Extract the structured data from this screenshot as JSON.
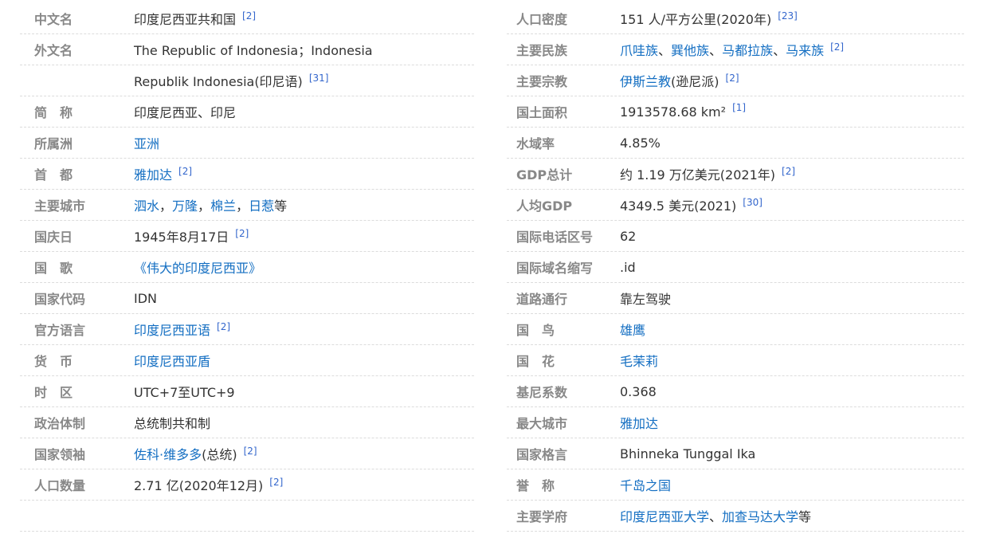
{
  "link_color": "#136ec2",
  "label_color": "#888888",
  "left": [
    {
      "label": "中文名",
      "segments": [
        {
          "t": "印度尼西亚共和国",
          "link": false
        }
      ],
      "ref": "[2]"
    },
    {
      "label": "外文名",
      "segments": [
        {
          "t": "The Republic of Indonesia；Indonesia",
          "link": false
        }
      ],
      "ref": ""
    },
    {
      "label": "",
      "segments": [
        {
          "t": "Republik Indonesia(印尼语)",
          "link": false
        }
      ],
      "ref": "[31]"
    },
    {
      "label": "简　称",
      "segments": [
        {
          "t": "印度尼西亚、印尼",
          "link": false
        }
      ],
      "ref": ""
    },
    {
      "label": "所属洲",
      "segments": [
        {
          "t": "亚洲",
          "link": true
        }
      ],
      "ref": ""
    },
    {
      "label": "首　都",
      "segments": [
        {
          "t": "雅加达",
          "link": true
        }
      ],
      "ref": "[2]"
    },
    {
      "label": "主要城市",
      "segments": [
        {
          "t": "泗水",
          "link": true
        },
        {
          "t": "，",
          "link": false
        },
        {
          "t": "万隆",
          "link": true
        },
        {
          "t": "，",
          "link": false
        },
        {
          "t": "棉兰",
          "link": true
        },
        {
          "t": "，",
          "link": false
        },
        {
          "t": "日惹",
          "link": true
        },
        {
          "t": "等",
          "link": false
        }
      ],
      "ref": ""
    },
    {
      "label": "国庆日",
      "segments": [
        {
          "t": "1945年8月17日",
          "link": false
        }
      ],
      "ref": "[2]"
    },
    {
      "label": "国　歌",
      "segments": [
        {
          "t": "《伟大的印度尼西亚》",
          "link": true
        }
      ],
      "ref": ""
    },
    {
      "label": "国家代码",
      "segments": [
        {
          "t": "IDN",
          "link": false
        }
      ],
      "ref": ""
    },
    {
      "label": "官方语言",
      "segments": [
        {
          "t": "印度尼西亚语",
          "link": true
        }
      ],
      "ref": "[2]"
    },
    {
      "label": "货　币",
      "segments": [
        {
          "t": "印度尼西亚盾",
          "link": true
        }
      ],
      "ref": ""
    },
    {
      "label": "时　区",
      "segments": [
        {
          "t": "UTC+7至UTC+9",
          "link": false
        }
      ],
      "ref": ""
    },
    {
      "label": "政治体制",
      "segments": [
        {
          "t": "总统制共和制",
          "link": false
        }
      ],
      "ref": ""
    },
    {
      "label": "国家领袖",
      "segments": [
        {
          "t": "佐科·维多多",
          "link": true
        },
        {
          "t": "(总统)",
          "link": false
        }
      ],
      "ref": "[2]"
    },
    {
      "label": "人口数量",
      "segments": [
        {
          "t": "2.71 亿(2020年12月)",
          "link": false
        }
      ],
      "ref": "[2]"
    },
    {
      "label": "",
      "segments": [],
      "ref": ""
    }
  ],
  "right": [
    {
      "label": "人口密度",
      "segments": [
        {
          "t": "151 人/平方公里(2020年)",
          "link": false
        }
      ],
      "ref": "[23]"
    },
    {
      "label": "主要民族",
      "segments": [
        {
          "t": "爪哇族",
          "link": true
        },
        {
          "t": "、",
          "link": false
        },
        {
          "t": "巽他族",
          "link": true
        },
        {
          "t": "、",
          "link": false
        },
        {
          "t": "马都拉族",
          "link": true
        },
        {
          "t": "、",
          "link": false
        },
        {
          "t": "马来族",
          "link": true
        }
      ],
      "ref": "[2]"
    },
    {
      "label": "主要宗教",
      "segments": [
        {
          "t": "伊斯兰教",
          "link": true
        },
        {
          "t": "(逊尼派)",
          "link": false
        }
      ],
      "ref": "[2]"
    },
    {
      "label": "国土面积",
      "segments": [
        {
          "t": "1913578.68 km²",
          "link": false
        }
      ],
      "ref": "[1]"
    },
    {
      "label": "水域率",
      "segments": [
        {
          "t": "4.85%",
          "link": false
        }
      ],
      "ref": ""
    },
    {
      "label": "GDP总计",
      "segments": [
        {
          "t": "约 1.19 万亿美元(2021年)",
          "link": false
        }
      ],
      "ref": "[2]"
    },
    {
      "label": "人均GDP",
      "segments": [
        {
          "t": "4349.5 美元(2021)",
          "link": false
        }
      ],
      "ref": "[30]"
    },
    {
      "label": "国际电话区号",
      "segments": [
        {
          "t": "62",
          "link": false
        }
      ],
      "ref": ""
    },
    {
      "label": "国际域名缩写",
      "segments": [
        {
          "t": ".id",
          "link": false
        }
      ],
      "ref": ""
    },
    {
      "label": "道路通行",
      "segments": [
        {
          "t": "靠左驾驶",
          "link": false
        }
      ],
      "ref": ""
    },
    {
      "label": "国　鸟",
      "segments": [
        {
          "t": "雄鹰",
          "link": true
        }
      ],
      "ref": ""
    },
    {
      "label": "国　花",
      "segments": [
        {
          "t": "毛茉莉",
          "link": true
        }
      ],
      "ref": ""
    },
    {
      "label": "基尼系数",
      "segments": [
        {
          "t": "0.368",
          "link": false
        }
      ],
      "ref": ""
    },
    {
      "label": "最大城市",
      "segments": [
        {
          "t": "雅加达",
          "link": true
        }
      ],
      "ref": ""
    },
    {
      "label": "国家格言",
      "segments": [
        {
          "t": "Bhinneka Tunggal Ika",
          "link": false
        }
      ],
      "ref": ""
    },
    {
      "label": "誉　称",
      "segments": [
        {
          "t": "千岛之国",
          "link": true
        }
      ],
      "ref": ""
    },
    {
      "label": "主要学府",
      "segments": [
        {
          "t": "印度尼西亚大学",
          "link": true
        },
        {
          "t": "、",
          "link": false
        },
        {
          "t": "加查马达大学",
          "link": true
        },
        {
          "t": "等",
          "link": false
        }
      ],
      "ref": ""
    }
  ]
}
